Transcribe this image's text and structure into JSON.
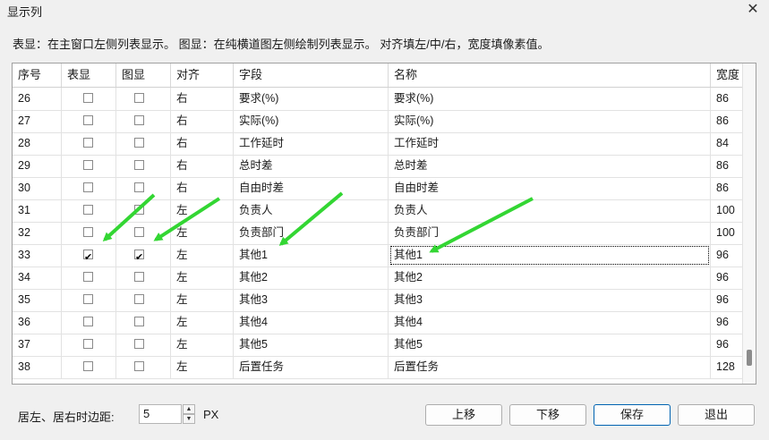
{
  "window": {
    "title": "显示列",
    "close_glyph": "✕"
  },
  "description": "表显：在主窗口左侧列表显示。 图显：在纯横道图左侧绘制列表显示。 对齐填左/中/右，宽度填像素值。",
  "columns": [
    "序号",
    "表显",
    "图显",
    "对齐",
    "字段",
    "名称",
    "宽度"
  ],
  "rows": [
    {
      "no": "26",
      "table": false,
      "chart": false,
      "align": "右",
      "field": "要求(%)",
      "name": "要求(%)",
      "width": "86"
    },
    {
      "no": "27",
      "table": false,
      "chart": false,
      "align": "右",
      "field": "实际(%)",
      "name": "实际(%)",
      "width": "86"
    },
    {
      "no": "28",
      "table": false,
      "chart": false,
      "align": "右",
      "field": "工作延时",
      "name": "工作延时",
      "width": "84"
    },
    {
      "no": "29",
      "table": false,
      "chart": false,
      "align": "右",
      "field": "总时差",
      "name": "总时差",
      "width": "86"
    },
    {
      "no": "30",
      "table": false,
      "chart": false,
      "align": "右",
      "field": "自由时差",
      "name": "自由时差",
      "width": "86"
    },
    {
      "no": "31",
      "table": false,
      "chart": false,
      "align": "左",
      "field": "负责人",
      "name": "负责人",
      "width": "100"
    },
    {
      "no": "32",
      "table": false,
      "chart": false,
      "align": "左",
      "field": "负责部门",
      "name": "负责部门",
      "width": "100"
    },
    {
      "no": "33",
      "table": true,
      "chart": true,
      "align": "左",
      "field": "其他1",
      "name": "其他1",
      "width": "96",
      "focused": true
    },
    {
      "no": "34",
      "table": false,
      "chart": false,
      "align": "左",
      "field": "其他2",
      "name": "其他2",
      "width": "96"
    },
    {
      "no": "35",
      "table": false,
      "chart": false,
      "align": "左",
      "field": "其他3",
      "name": "其他3",
      "width": "96"
    },
    {
      "no": "36",
      "table": false,
      "chart": false,
      "align": "左",
      "field": "其他4",
      "name": "其他4",
      "width": "96"
    },
    {
      "no": "37",
      "table": false,
      "chart": false,
      "align": "左",
      "field": "其他5",
      "name": "其他5",
      "width": "96"
    },
    {
      "no": "38",
      "table": false,
      "chart": false,
      "align": "左",
      "field": "后置任务",
      "name": "后置任务",
      "width": "128"
    }
  ],
  "footer": {
    "margin_label": "居左、居右时边距:",
    "margin_value": "5",
    "unit": "PX",
    "buttons": {
      "up": "上移",
      "down": "下移",
      "save": "保存",
      "exit": "退出"
    }
  },
  "annotation_color": "#33d633"
}
